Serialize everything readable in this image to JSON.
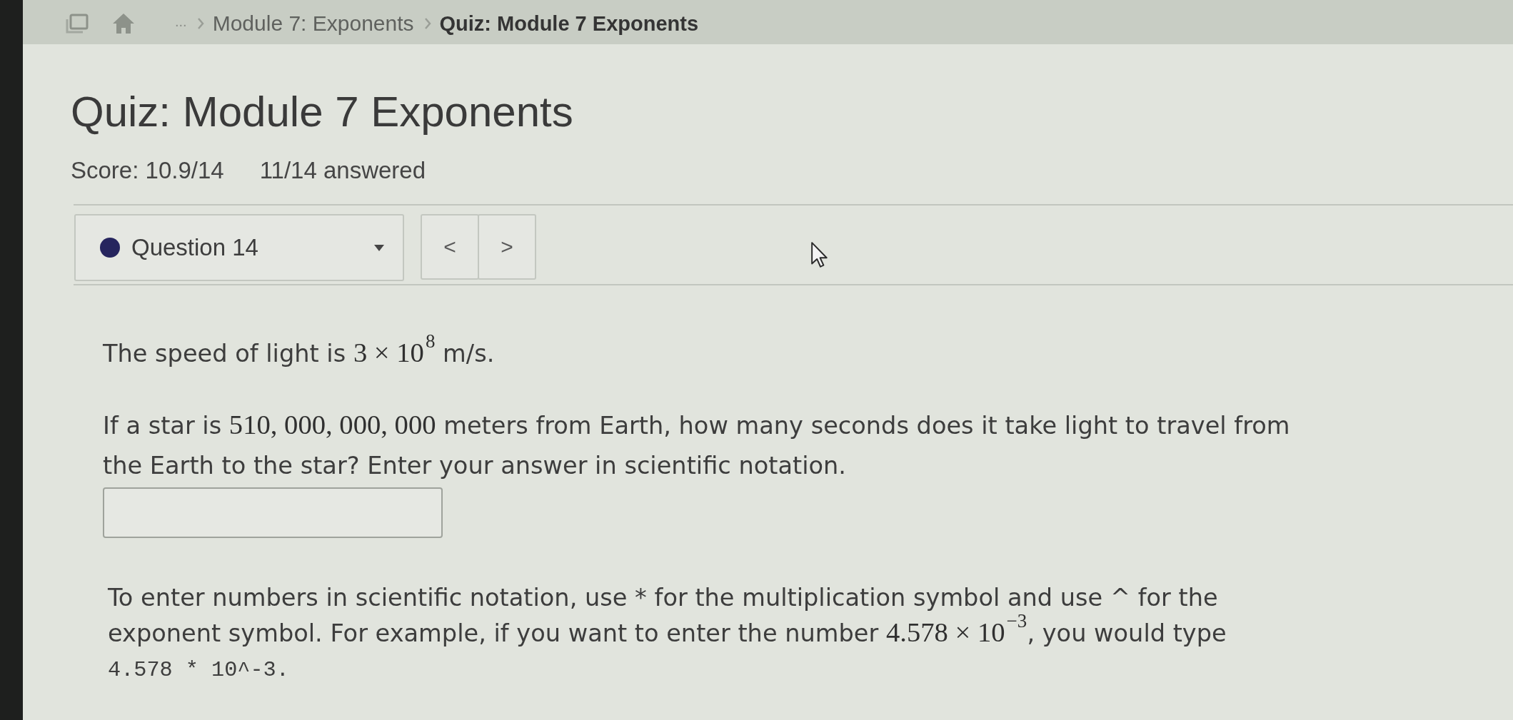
{
  "breadcrumb": {
    "items": [
      {
        "kind": "ellipsis",
        "label": "..."
      },
      {
        "kind": "link",
        "label": "Module 7: Exponents"
      },
      {
        "kind": "page",
        "label": "Quiz: Module 7 Exponents"
      }
    ]
  },
  "quiz": {
    "title": "Quiz: Module 7 Exponents",
    "score": "Score: 10.9/14",
    "progress": "11/14 answered"
  },
  "question_selector": {
    "label": "Question 14"
  },
  "nav_buttons": [
    {
      "label": "<"
    },
    {
      "label": ">"
    }
  ],
  "question": {
    "paragraphs": [
      [
        {
          "kind": "text",
          "text": "The speed of light is "
        },
        {
          "kind": "math",
          "text": "3 × 10$^{8}$"
        },
        {
          "kind": "text",
          "text": " m/s."
        }
      ],
      [
        {
          "kind": "text",
          "text": "If a star is "
        },
        {
          "kind": "math",
          "text": "510, 000, 000, 000"
        },
        {
          "kind": "text",
          "text": " meters from Earth, how many seconds does it take light to travel from the Earth to the star? Enter your answer in scientific notation."
        }
      ]
    ]
  },
  "instructions": {
    "segments": [
      {
        "kind": "text",
        "text": "To enter numbers in scientific notation, use * for the multiplication symbol and use ^ for the exponent symbol. For example, if you want to enter the number "
      },
      {
        "kind": "math",
        "text": "4.578 × 10$^{−3}$"
      },
      {
        "kind": "text",
        "text": ", you would type "
      },
      {
        "kind": "code",
        "text": "4.578 * 10^-3."
      }
    ]
  }
}
